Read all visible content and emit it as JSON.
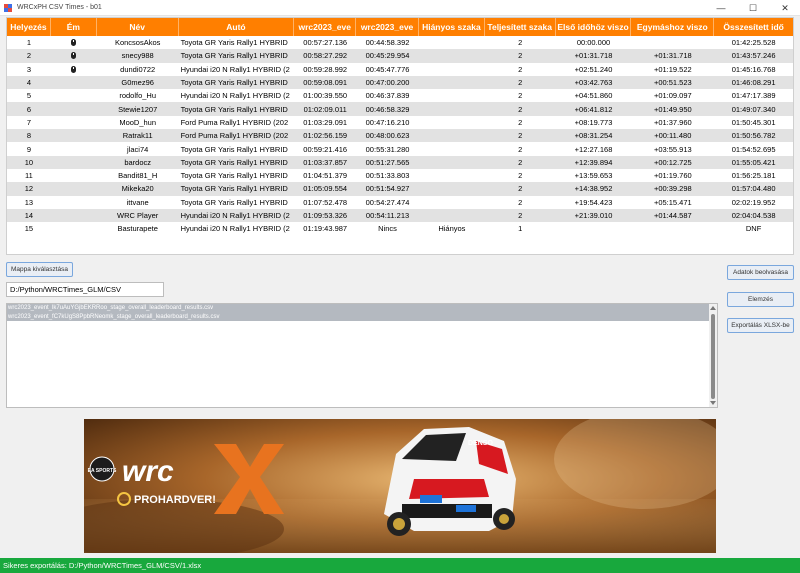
{
  "window": {
    "title": "WRCxPH CSV Times - b01",
    "minimize": "—",
    "maximize": "☐",
    "close": "✕"
  },
  "table": {
    "headers": [
      "Helyezés",
      "Ém",
      "Név",
      "Autó",
      "wrc2023_eve",
      "wrc2023_eve",
      "Hiányos szaka",
      "Teljesített szaka",
      "Első időhöz viszo",
      "Egymáshoz viszo",
      "Összesített idő"
    ],
    "rows": [
      {
        "pos": "1",
        "medal": "icon",
        "name": "KoncsosAkos",
        "car": "Toyota GR Yaris Rally1 HYBRID",
        "t1": "00:57:27.136",
        "t2": "00:44:58.392",
        "missing": "",
        "done": "2",
        "first": "00:00.000",
        "prev": "",
        "total": "01:42:25.528"
      },
      {
        "pos": "2",
        "medal": "icon",
        "name": "snecy988",
        "car": "Toyota GR Yaris Rally1 HYBRID",
        "t1": "00:58:27.292",
        "t2": "00:45:29.954",
        "missing": "",
        "done": "2",
        "first": "+01:31.718",
        "prev": "+01:31.718",
        "total": "01:43:57.246"
      },
      {
        "pos": "3",
        "medal": "icon",
        "name": "dundi0722",
        "car": "Hyundai i20 N Rally1 HYBRID (2",
        "t1": "00:59:28.992",
        "t2": "00:45:47.776",
        "missing": "",
        "done": "2",
        "first": "+02:51.240",
        "prev": "+01:19.522",
        "total": "01:45:16.768"
      },
      {
        "pos": "4",
        "medal": "",
        "name": "G0mez96",
        "car": "Toyota GR Yaris Rally1 HYBRID",
        "t1": "00:59:08.091",
        "t2": "00:47:00.200",
        "missing": "",
        "done": "2",
        "first": "+03:42.763",
        "prev": "+00:51.523",
        "total": "01:46:08.291"
      },
      {
        "pos": "5",
        "medal": "",
        "name": "rodolfo_Hu",
        "car": "Hyundai i20 N Rally1 HYBRID (2",
        "t1": "01:00:39.550",
        "t2": "00:46:37.839",
        "missing": "",
        "done": "2",
        "first": "+04:51.860",
        "prev": "+01:09.097",
        "total": "01:47:17.389"
      },
      {
        "pos": "6",
        "medal": "",
        "name": "Stewie1207",
        "car": "Toyota GR Yaris Rally1 HYBRID",
        "t1": "01:02:09.011",
        "t2": "00:46:58.329",
        "missing": "",
        "done": "2",
        "first": "+06:41.812",
        "prev": "+01:49.950",
        "total": "01:49:07.340"
      },
      {
        "pos": "7",
        "medal": "",
        "name": "MooD_hun",
        "car": "Ford Puma Rally1 HYBRID (202",
        "t1": "01:03:29.091",
        "t2": "00:47:16.210",
        "missing": "",
        "done": "2",
        "first": "+08:19.773",
        "prev": "+01:37.960",
        "total": "01:50:45.301"
      },
      {
        "pos": "8",
        "medal": "",
        "name": "Ratrak11",
        "car": "Ford Puma Rally1 HYBRID (202",
        "t1": "01:02:56.159",
        "t2": "00:48:00.623",
        "missing": "",
        "done": "2",
        "first": "+08:31.254",
        "prev": "+00:11.480",
        "total": "01:50:56.782"
      },
      {
        "pos": "9",
        "medal": "",
        "name": "jlaci74",
        "car": "Toyota GR Yaris Rally1 HYBRID",
        "t1": "00:59:21.416",
        "t2": "00:55:31.280",
        "missing": "",
        "done": "2",
        "first": "+12:27.168",
        "prev": "+03:55.913",
        "total": "01:54:52.695"
      },
      {
        "pos": "10",
        "medal": "",
        "name": "bardocz",
        "car": "Toyota GR Yaris Rally1 HYBRID",
        "t1": "01:03:37.857",
        "t2": "00:51:27.565",
        "missing": "",
        "done": "2",
        "first": "+12:39.894",
        "prev": "+00:12.725",
        "total": "01:55:05.421"
      },
      {
        "pos": "11",
        "medal": "",
        "name": "Bandit81_H",
        "car": "Toyota GR Yaris Rally1 HYBRID",
        "t1": "01:04:51.379",
        "t2": "00:51:33.803",
        "missing": "",
        "done": "2",
        "first": "+13:59.653",
        "prev": "+01:19.760",
        "total": "01:56:25.181"
      },
      {
        "pos": "12",
        "medal": "",
        "name": "Mikeka20",
        "car": "Toyota GR Yaris Rally1 HYBRID",
        "t1": "01:05:09.554",
        "t2": "00:51:54.927",
        "missing": "",
        "done": "2",
        "first": "+14:38.952",
        "prev": "+00:39.298",
        "total": "01:57:04.480"
      },
      {
        "pos": "13",
        "medal": "",
        "name": "ittvane",
        "car": "Toyota GR Yaris Rally1 HYBRID",
        "t1": "01:07:52.478",
        "t2": "00:54:27.474",
        "missing": "",
        "done": "2",
        "first": "+19:54.423",
        "prev": "+05:15.471",
        "total": "02:02:19.952"
      },
      {
        "pos": "14",
        "medal": "",
        "name": "WRC Player",
        "car": "Hyundai i20 N Rally1 HYBRID (2",
        "t1": "01:09:53.326",
        "t2": "00:54:11.213",
        "missing": "",
        "done": "2",
        "first": "+21:39.010",
        "prev": "+01:44.587",
        "total": "02:04:04.538"
      },
      {
        "pos": "15",
        "medal": "",
        "name": "Basturapete",
        "car": "Hyundai i20 N Rally1 HYBRID (2",
        "t1": "01:19:43.987",
        "t2": "Nincs",
        "missing": "Hiányos",
        "done": "1",
        "first": "",
        "prev": "",
        "total": "DNF"
      }
    ]
  },
  "buttons": {
    "select_folder": "Mappa kiválasztása",
    "load_data": "Adatok beolvasása",
    "analyze": "Elemzés",
    "export": "Exportálás XLSX-be"
  },
  "path_value": "D:/Python/WRCTimes_GLM/CSV",
  "files": [
    "wrc2023_event_lk7uAuYGjbEKRRoo_stage_overall_leaderboard_results.csv",
    "wrc2023_event_fC7kUgS8PpbRNeomk_stage_overall_leaderboard_results.csv"
  ],
  "banner": {
    "badge": "EA SPORTS",
    "logo": "wrc",
    "partner": "PROHARDVER!",
    "sponsor": "DENSO"
  },
  "status": "Sikeres exportálás: D:/Python/WRCTimes_GLM/CSV/1.xlsx",
  "colors": {
    "header": "#ff7f00",
    "status": "#18a83d",
    "selected": "#b4b9c0"
  }
}
